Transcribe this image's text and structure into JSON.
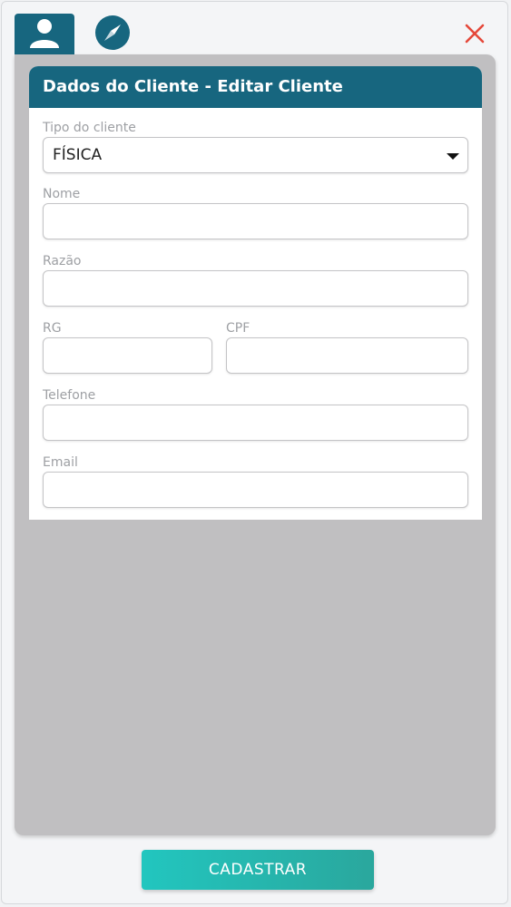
{
  "tabs": {
    "user_icon": "user-icon",
    "compass_icon": "compass-icon",
    "close_icon": "close-icon"
  },
  "card": {
    "title": "Dados do Cliente - Editar Cliente"
  },
  "form": {
    "tipo_label": "Tipo do cliente",
    "tipo_value": "FÍSICA",
    "nome_label": "Nome",
    "nome_value": "",
    "razao_label": "Razão",
    "razao_value": "",
    "rg_label": "RG",
    "rg_value": "",
    "cpf_label": "CPF",
    "cpf_value": "",
    "telefone_label": "Telefone",
    "telefone_value": "",
    "email_label": "Email",
    "email_value": ""
  },
  "actions": {
    "submit_label": "CADASTRAR"
  },
  "colors": {
    "header": "#17667f",
    "close": "#e5483a",
    "button_start": "#22c6bf",
    "button_end": "#2aa79d",
    "panel": "#c0bfc1"
  }
}
